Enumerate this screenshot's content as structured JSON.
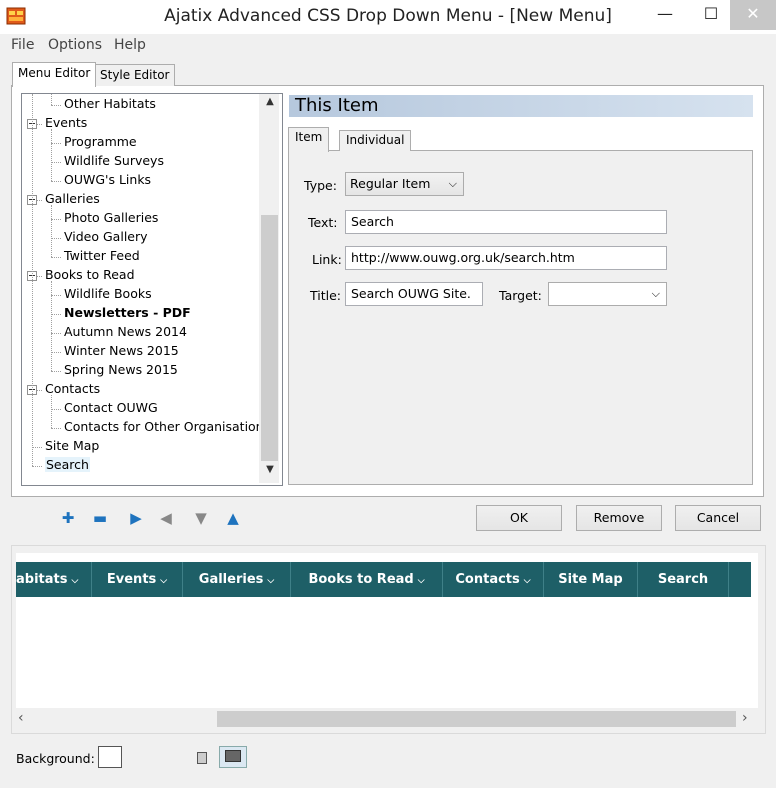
{
  "window": {
    "title": "Ajatix Advanced CSS Drop Down Menu - [New Menu]",
    "minimize_glyph": "—",
    "maximize_glyph": "☐",
    "close_glyph": "✕"
  },
  "menubar": {
    "items": [
      "File",
      "Options",
      "Help"
    ]
  },
  "outer_tabs": {
    "menu_editor": "Menu Editor",
    "style_editor": "Style Editor"
  },
  "tree": {
    "nodes": [
      {
        "label": "Other Habitats",
        "level": 2
      },
      {
        "label": "Events",
        "level": 1,
        "expanded": true
      },
      {
        "label": "Programme",
        "level": 2
      },
      {
        "label": "Wildlife Surveys",
        "level": 2
      },
      {
        "label": "OUWG's Links",
        "level": 2
      },
      {
        "label": "Galleries",
        "level": 1,
        "expanded": true
      },
      {
        "label": "Photo Galleries",
        "level": 2
      },
      {
        "label": "Video Gallery",
        "level": 2
      },
      {
        "label": "Twitter Feed",
        "level": 2
      },
      {
        "label": "Books to Read",
        "level": 1,
        "expanded": true
      },
      {
        "label": "Wildlife Books",
        "level": 2
      },
      {
        "label": "Newsletters - PDF",
        "level": 2,
        "bold": true
      },
      {
        "label": "Autumn News 2014",
        "level": 2
      },
      {
        "label": "Winter News 2015",
        "level": 2
      },
      {
        "label": "Spring News 2015",
        "level": 2
      },
      {
        "label": "Contacts",
        "level": 1,
        "expanded": true
      },
      {
        "label": "Contact OUWG",
        "level": 2
      },
      {
        "label": "Contacts for Other Organisations",
        "level": 2
      },
      {
        "label": "Site Map",
        "level": 1
      },
      {
        "label": "Search",
        "level": 1,
        "selected": true
      }
    ]
  },
  "item_panel": {
    "header": "This Item",
    "tabs": {
      "item": "Item",
      "individual": "Individual"
    },
    "type_label": "Type:",
    "type_value": "Regular Item",
    "text_label": "Text:",
    "text_value": "Search",
    "link_label": "Link:",
    "link_value": "http://www.ouwg.org.uk/search.htm",
    "title_label": "Title:",
    "title_value": "Search OUWG Site.",
    "target_label": "Target:",
    "target_value": ""
  },
  "buttons": {
    "ok": "OK",
    "remove": "Remove",
    "cancel": "Cancel"
  },
  "preview": {
    "menu_color": "#1e5f67",
    "items": [
      {
        "label": "abitats",
        "has_submenu": true
      },
      {
        "label": "Events",
        "has_submenu": true
      },
      {
        "label": "Galleries",
        "has_submenu": true
      },
      {
        "label": "Books to Read",
        "has_submenu": true
      },
      {
        "label": "Contacts",
        "has_submenu": true
      },
      {
        "label": "Site Map",
        "has_submenu": false
      },
      {
        "label": "Search",
        "has_submenu": false
      }
    ]
  },
  "bottom": {
    "background_label": "Background:"
  },
  "colors": {
    "accent_icon": "#1e73be",
    "selected_tree_bg": "#e5f3fb"
  }
}
